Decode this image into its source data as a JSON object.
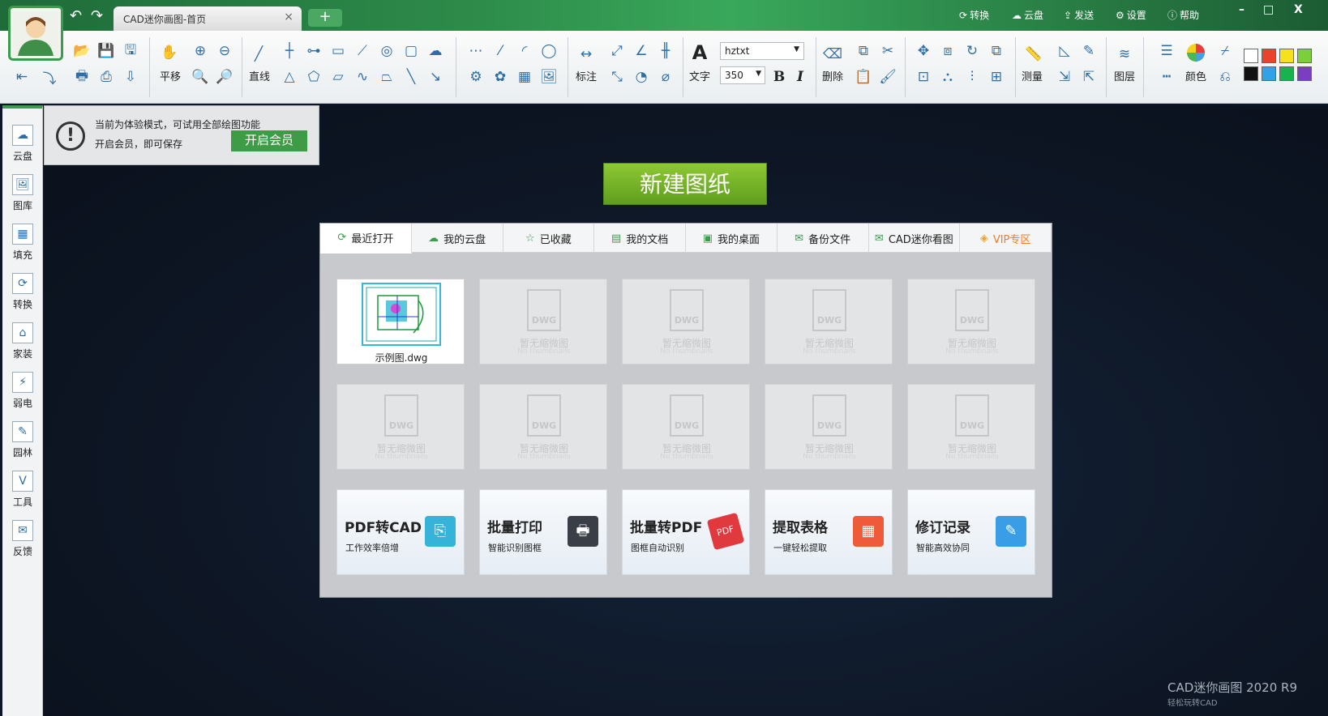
{
  "window": {
    "tab_title": "CAD迷你画图-首页",
    "tab_close": "×",
    "tab_add": "+",
    "top_right": [
      {
        "label": "转换",
        "icon": "refresh-icon"
      },
      {
        "label": "云盘",
        "icon": "cloud-icon"
      },
      {
        "label": "发送",
        "icon": "send-icon"
      },
      {
        "label": "设置",
        "icon": "gear-icon"
      },
      {
        "label": "帮助",
        "icon": "help-icon"
      }
    ],
    "controls": [
      "–",
      "□",
      "X"
    ]
  },
  "toolbar": {
    "pan": "平移",
    "line": "直线",
    "dimension": "标注",
    "text": "文字",
    "font_name": "hztxt",
    "font_size": "350",
    "bold": "B",
    "italic": "I",
    "delete": "删除",
    "measure": "测量",
    "layer": "图层",
    "color": "颜色",
    "text_glyph": "A"
  },
  "sidebar": {
    "items": [
      {
        "label": "云盘",
        "icon": "cloud-icon"
      },
      {
        "label": "图库",
        "icon": "gallery-icon"
      },
      {
        "label": "填充",
        "icon": "hatch-icon"
      },
      {
        "label": "转换",
        "icon": "convert-icon"
      },
      {
        "label": "家装",
        "icon": "home-decor-icon"
      },
      {
        "label": "弱电",
        "icon": "low-voltage-icon"
      },
      {
        "label": "园林",
        "icon": "garden-icon"
      },
      {
        "label": "工具",
        "icon": "tools-icon"
      },
      {
        "label": "反馈",
        "icon": "feedback-icon"
      }
    ]
  },
  "trial_notice": {
    "line1": "当前为体验模式，可试用全部绘图功能",
    "line2": "开启会员，即可保存",
    "button": "开启会员",
    "icon": "!"
  },
  "new_drawing_button": "新建图纸",
  "tabs": [
    {
      "label": "最近打开",
      "icon": "refresh-icon",
      "active": true
    },
    {
      "label": "我的云盘",
      "icon": "cloud-icon",
      "active": false
    },
    {
      "label": "已收藏",
      "icon": "star-icon",
      "active": false
    },
    {
      "label": "我的文档",
      "icon": "document-icon",
      "active": false
    },
    {
      "label": "我的桌面",
      "icon": "desktop-icon",
      "active": false
    },
    {
      "label": "备份文件",
      "icon": "mail-icon",
      "active": false
    },
    {
      "label": "CAD迷你看图",
      "icon": "mail-icon",
      "active": false
    },
    {
      "label": "VIP专区",
      "icon": "vip-icon",
      "active": false
    }
  ],
  "files": {
    "first_name": "示例图.dwg",
    "placeholder_badge": "DWG",
    "placeholder_text": "暂无缩微图",
    "placeholder_sub": "No thumbnails"
  },
  "features": [
    {
      "title": "PDF转CAD",
      "subtitle": "工作效率倍增",
      "icon": "pdf-to-cad-icon",
      "color": "#36b3d9"
    },
    {
      "title": "批量打印",
      "subtitle": "智能识别图框",
      "icon": "printer-icon",
      "color": "#3a3f47"
    },
    {
      "title": "批量转PDF",
      "subtitle": "图框自动识别",
      "icon": "pdf-icon",
      "color": "#e0393e"
    },
    {
      "title": "提取表格",
      "subtitle": "一键轻松提取",
      "icon": "table-icon",
      "color": "#ee5a3a"
    },
    {
      "title": "修订记录",
      "subtitle": "智能高效协同",
      "icon": "revision-icon",
      "color": "#3a9ee6"
    }
  ],
  "brand": {
    "name": "CAD迷你画图 2020 R9",
    "tagline": "轻松玩转CAD"
  },
  "colors": {
    "accent_green": "#3e9b46",
    "vip_orange": "#f07c2c",
    "palette": [
      "#ffffff",
      "#e8432c",
      "#f5e11d",
      "#7bcf3a",
      "#111111",
      "#2ea3e8",
      "#18b24f",
      "#7a3fc0"
    ]
  }
}
